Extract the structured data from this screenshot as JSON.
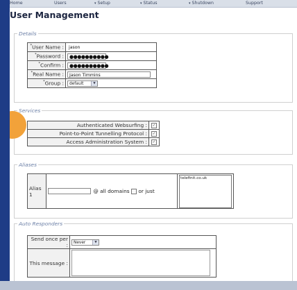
{
  "nav": [
    {
      "label": "Home",
      "arrow": false
    },
    {
      "label": "Users",
      "arrow": false
    },
    {
      "label": "Setup",
      "arrow": true
    },
    {
      "label": "Status",
      "arrow": true
    },
    {
      "label": "Shutdown",
      "arrow": true
    },
    {
      "label": "Support",
      "arrow": false
    }
  ],
  "page_title": "User Management",
  "details": {
    "legend": "Details",
    "user_name_label": "User Name :",
    "user_name_value": "jason",
    "password_label": "Password :",
    "password_value": "●●●●●●●●●●",
    "confirm_label": "Confirm :",
    "confirm_value": "●●●●●●●●●●",
    "real_name_label": "Real Name :",
    "real_name_value": "Jason Timmins",
    "group_label": "Group :",
    "group_value": "default"
  },
  "services": {
    "legend": "Services",
    "rows": [
      {
        "label": "Authenticated Websurfing :",
        "checked": true
      },
      {
        "label": "Point-to-Point Tunnelling Protocol :",
        "checked": true
      },
      {
        "label": "Access Administration System :",
        "checked": true
      }
    ]
  },
  "aliases": {
    "legend": "Aliases",
    "alias_label": "Alias 1",
    "at_domains": "@ all domains",
    "or_just": "or just",
    "domain_list_item": "telefinit.co.uk"
  },
  "auto_responders": {
    "legend": "Auto Responders",
    "send_once_label": "Send once per :",
    "send_once_value": "Never",
    "message_label": "This message :"
  },
  "colors": {
    "accent": "#f2a23a",
    "frame": "#2a4d9e",
    "legend": "#6b7fa6"
  },
  "icons": {
    "check": "checkbox-checked-icon",
    "dropdown": "chevron-down-icon"
  }
}
